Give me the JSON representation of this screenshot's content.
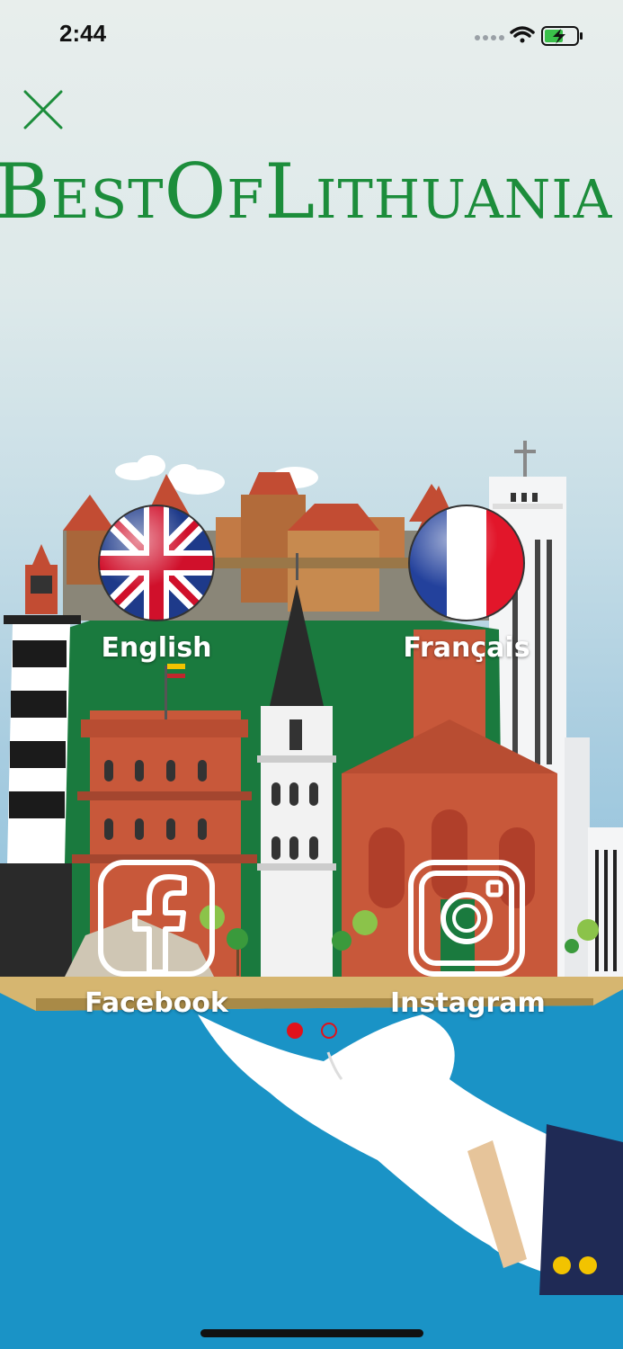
{
  "status_bar": {
    "time": "2:44",
    "icons": [
      "signal-dots-icon",
      "wifi-icon",
      "battery-charging-icon"
    ]
  },
  "header": {
    "close_icon": "close-icon",
    "brand": "BestOfLithuania",
    "brand_color": "#1c8d3b"
  },
  "languages": [
    {
      "label": "English",
      "icon": "uk-flag-icon"
    },
    {
      "label": "Français",
      "icon": "france-flag-icon"
    }
  ],
  "social": [
    {
      "label": "Facebook",
      "icon": "facebook-icon"
    },
    {
      "label": "Instagram",
      "icon": "instagram-icon"
    }
  ],
  "pager": {
    "pages": 2,
    "active": 1,
    "active_color": "#e0121b"
  },
  "colors": {
    "sea": "#1a93c6",
    "brick": "#c8583a",
    "hill": "#1a7a3e",
    "sleeve": "#1f2a55"
  }
}
